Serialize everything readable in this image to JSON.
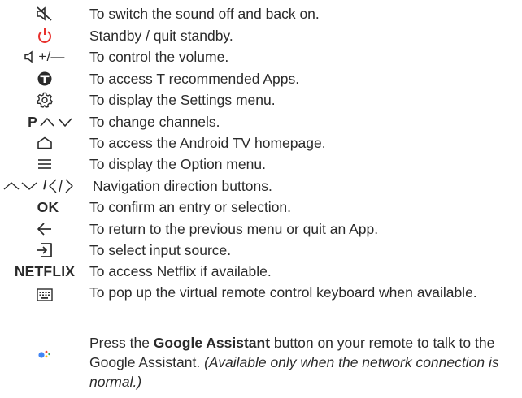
{
  "icons": {
    "power_color": "#e8312d",
    "assistant_colors": [
      "#4285f4",
      "#ea4335",
      "#fbbc05",
      "#34a853"
    ]
  },
  "labels": {
    "volume": "+/—",
    "channel": "P",
    "navigation": "/",
    "ok": "OK",
    "netflix": "NETFLIX"
  },
  "items": [
    {
      "icon": "mute-icon",
      "text": "To switch the sound off and back on."
    },
    {
      "icon": "power-icon",
      "text": "Standby / quit standby."
    },
    {
      "icon": "volume-icon",
      "text": "To control the volume."
    },
    {
      "icon": "t-logo-icon",
      "text": "To access T recommended Apps."
    },
    {
      "icon": "settings-gear-icon",
      "text": "To display the Settings menu."
    },
    {
      "icon": "channel-icon",
      "text": "To change channels."
    },
    {
      "icon": "home-icon",
      "text": "To access the Android TV homepage."
    },
    {
      "icon": "option-menu-icon",
      "text": "To display the Option menu."
    },
    {
      "icon": "navigation-arrows-icon",
      "text": "Navigation direction buttons."
    },
    {
      "icon": "ok-label",
      "text": "To confirm an entry or selection."
    },
    {
      "icon": "back-arrow-icon",
      "text": "To return to the previous menu or quit an App."
    },
    {
      "icon": "input-source-icon",
      "text": "To select input source."
    },
    {
      "icon": "netflix-label",
      "text": "To access Netflix if available."
    },
    {
      "icon": "keyboard-icon",
      "text": "To pop up the virtual remote control keyboard when available."
    },
    {
      "icon": "google-assistant-icon",
      "text_pre": "Press the ",
      "text_bold": "Google Assistant",
      "text_mid": " button on your remote to talk to the Google Assistant. ",
      "text_italic": "(Available only when the network connection is normal.)"
    }
  ]
}
